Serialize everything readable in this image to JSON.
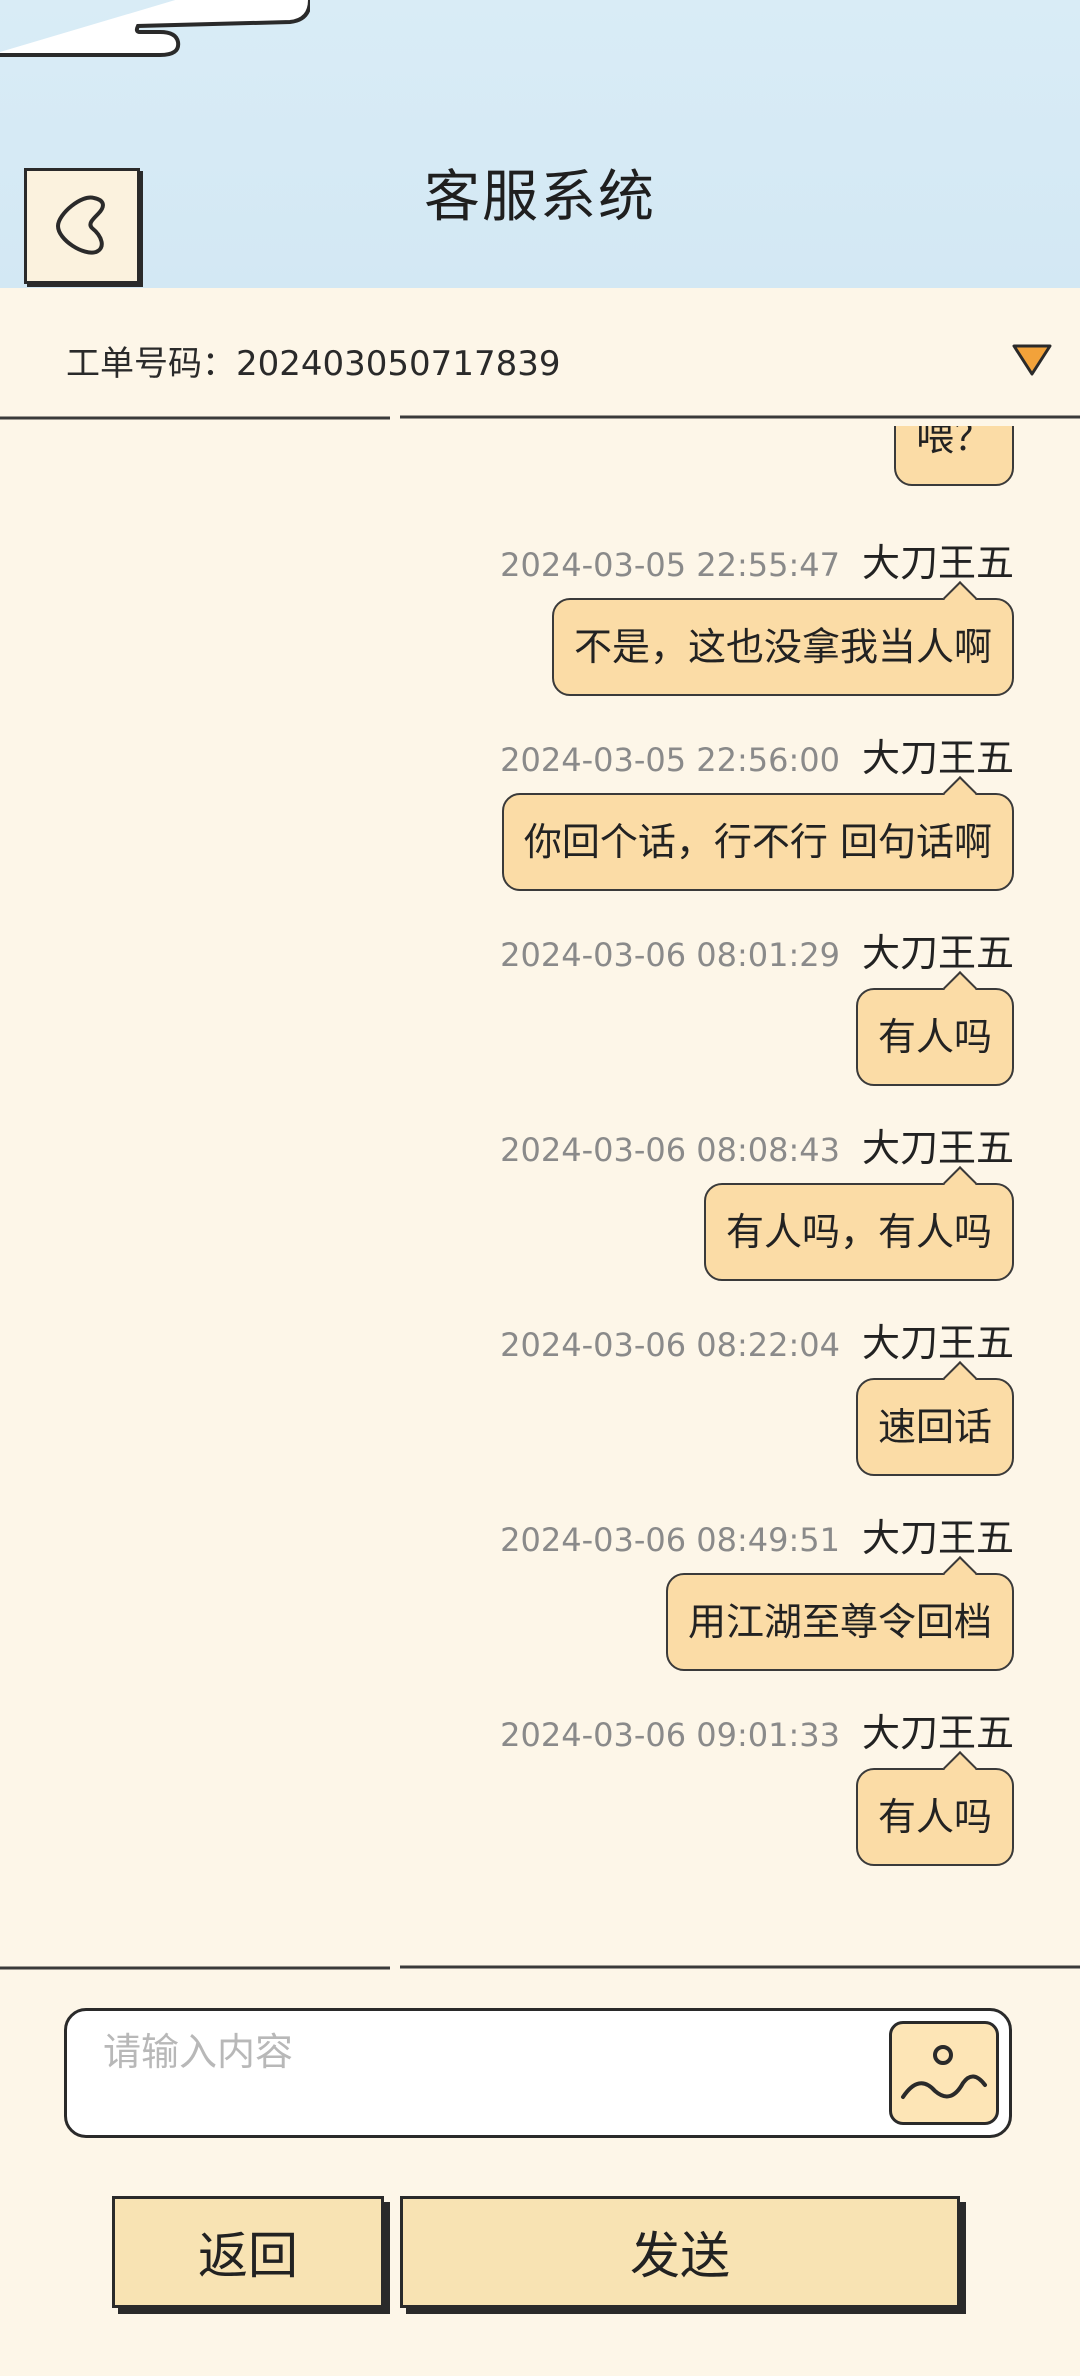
{
  "header": {
    "title": "客服系统"
  },
  "ticket": {
    "label": "工单号码：202403050717839"
  },
  "messages": [
    {
      "time": "",
      "sender": "",
      "text": "喂？"
    },
    {
      "time": "2024-03-05 22:55:47",
      "sender": "大刀王五",
      "text": "不是，这也没拿我当人啊"
    },
    {
      "time": "2024-03-05 22:56:00",
      "sender": "大刀王五",
      "text": "你回个话，行不行 回句话啊"
    },
    {
      "time": "2024-03-06 08:01:29",
      "sender": "大刀王五",
      "text": "有人吗"
    },
    {
      "time": "2024-03-06 08:08:43",
      "sender": "大刀王五",
      "text": "有人吗，有人吗"
    },
    {
      "time": "2024-03-06 08:22:04",
      "sender": "大刀王五",
      "text": "速回话"
    },
    {
      "time": "2024-03-06 08:49:51",
      "sender": "大刀王五",
      "text": "用江湖至尊令回档"
    },
    {
      "time": "2024-03-06 09:01:33",
      "sender": "大刀王五",
      "text": "有人吗"
    }
  ],
  "input": {
    "placeholder": "请输入内容",
    "value": ""
  },
  "buttons": {
    "back": "返回",
    "send": "发送"
  },
  "colors": {
    "background": "#fdf6e8",
    "header": "#d9ecf6",
    "bubble": "#fbdca6",
    "button": "#f8e3b3",
    "dropdown_arrow": "#f2a23a"
  },
  "icons": {
    "back": "back-icon",
    "toggle": "triangle-down-icon",
    "image": "image-icon"
  }
}
